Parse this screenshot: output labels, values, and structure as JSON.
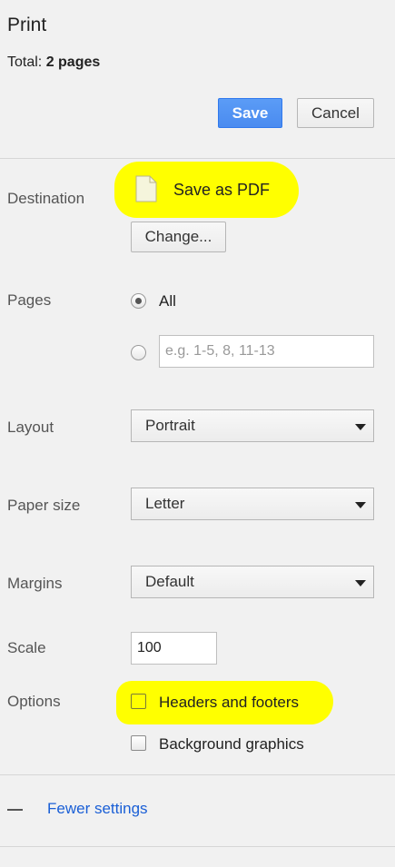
{
  "header": {
    "title": "Print",
    "total_prefix": "Total: ",
    "total_value": "2 pages",
    "save_label": "Save",
    "cancel_label": "Cancel"
  },
  "destination": {
    "label": "Destination",
    "name": "Save as PDF",
    "icon": "document-icon",
    "change_label": "Change..."
  },
  "pages": {
    "label": "Pages",
    "all_label": "All",
    "all_selected": true,
    "custom_placeholder": "e.g. 1-5, 8, 11-13",
    "custom_value": ""
  },
  "layout": {
    "label": "Layout",
    "value": "Portrait"
  },
  "paper_size": {
    "label": "Paper size",
    "value": "Letter"
  },
  "margins": {
    "label": "Margins",
    "value": "Default"
  },
  "scale": {
    "label": "Scale",
    "value": "100"
  },
  "options": {
    "label": "Options",
    "headers_footers_label": "Headers and footers",
    "headers_footers_checked": false,
    "background_graphics_label": "Background graphics",
    "background_graphics_checked": false
  },
  "footer": {
    "fewer_settings_label": "Fewer settings"
  },
  "colors": {
    "highlight": "#ffff00",
    "save_button": "#4a8bf0",
    "link": "#1a5fd6",
    "background": "#f1f1f1"
  }
}
